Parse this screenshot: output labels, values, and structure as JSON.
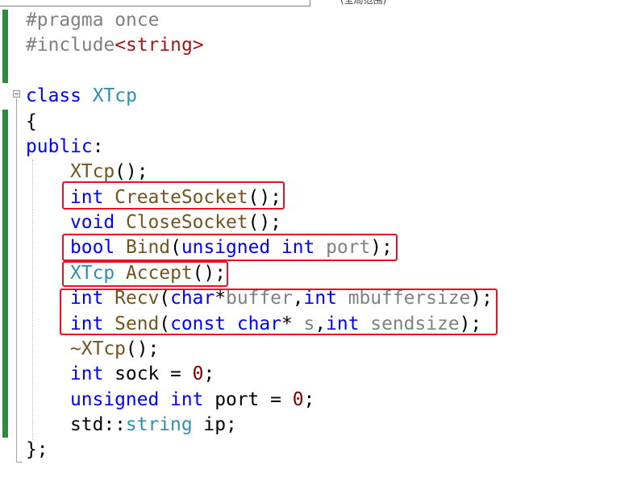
{
  "top_hint": "(全局范围)",
  "lines": {
    "pragma_directive": "#pragma",
    "pragma_value": " once",
    "include_directive": "#include",
    "include_header": "<string>",
    "class_kw": "class",
    "class_name": "XTcp",
    "open_brace": "{",
    "access_public": "public",
    "colon": ":",
    "ctor_name": "XTcp",
    "ctor_tail": "();",
    "create_type": "int",
    "create_name": "CreateSocket",
    "create_tail": "();",
    "close_type": "void",
    "close_name": "CloseSocket",
    "close_tail": "();",
    "bind_type": "bool",
    "bind_name": "Bind",
    "bind_paren": "(",
    "bind_p1": "unsigned",
    "bind_p2": "int",
    "bind_p3": "port",
    "bind_tail": ");",
    "accept_type": "XTcp",
    "accept_name": "Accept",
    "accept_tail": "();",
    "recv_type": "int",
    "recv_name": "Recv",
    "recv_paren": "(",
    "recv_p1": "char",
    "recv_star": "*",
    "recv_p2": "buffer",
    "recv_comma": ",",
    "recv_p3": "int",
    "recv_p4": "mbuffersize",
    "recv_tail": ");",
    "send_type": "int",
    "send_name": "Send",
    "send_paren": "(",
    "send_p1": "const",
    "send_p2": "char",
    "send_star": "*",
    "send_p3": "s",
    "send_comma": ",",
    "send_p4": "int",
    "send_p5": "sendsize",
    "send_tail": ");",
    "dtor_name": "~XTcp",
    "dtor_tail": "();",
    "sock_type": "int",
    "sock_rest": " sock = ",
    "sock_value": "0",
    "sock_semi": ";",
    "port_type1": "unsigned",
    "port_type2": "int",
    "port_rest": " port = ",
    "port_value": "0",
    "port_semi": ";",
    "ip_ns": "std::",
    "ip_type": "string",
    "ip_rest": " ip;",
    "close_brace": "};"
  },
  "colors": {
    "keyword": "#0000ff",
    "type": "#2b91af",
    "function": "#74531f",
    "parameter": "#808080",
    "string": "#a31515",
    "number": "#800000",
    "change_bar": "#2e8b3a",
    "highlight_box": "#e81123"
  }
}
